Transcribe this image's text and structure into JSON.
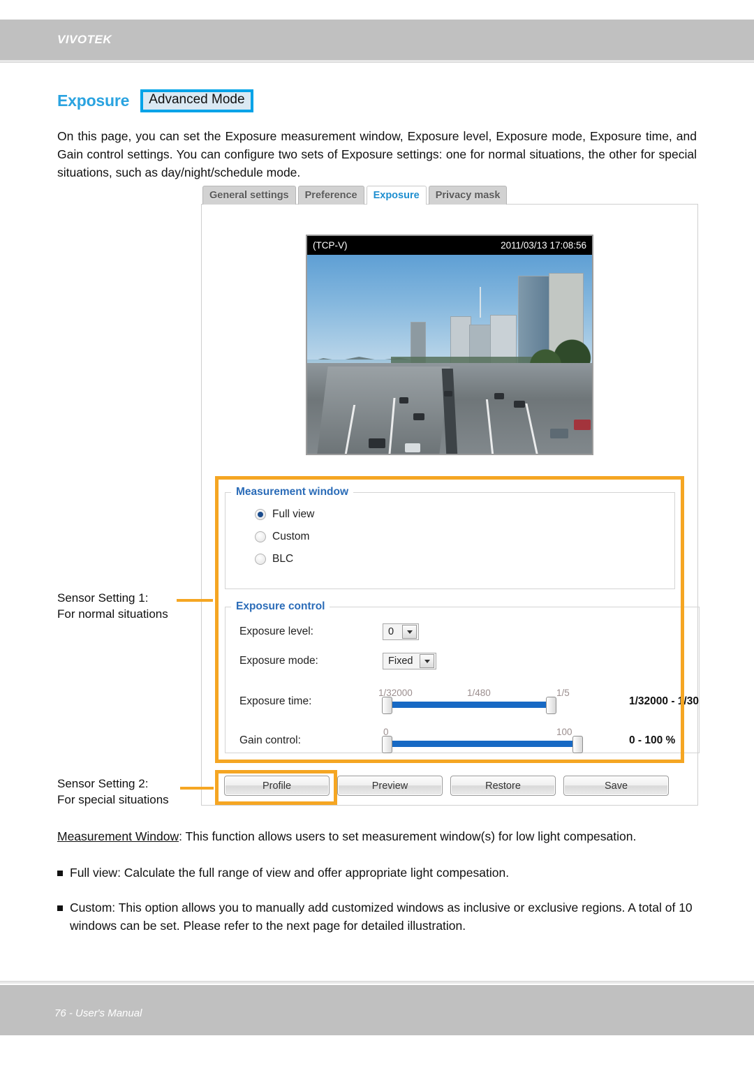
{
  "header": {
    "brand": "VIVOTEK"
  },
  "page": {
    "title": "Exposure",
    "mode_badge": "Advanced Mode",
    "intro": "On this page, you can set the Exposure measurement window, Exposure level, Exposure mode, Exposure time, and Gain control settings. You can configure two sets of Exposure settings: one for normal situations, the other for special situations, such as day/night/schedule mode."
  },
  "screenshot": {
    "tabs": [
      {
        "label": "General settings",
        "active": false
      },
      {
        "label": "Preference",
        "active": false
      },
      {
        "label": "Exposure",
        "active": true
      },
      {
        "label": "Privacy mask",
        "active": false
      }
    ],
    "video": {
      "stream_label": "(TCP-V)",
      "timestamp": "2011/03/13  17:08:56"
    },
    "measurement_window": {
      "legend": "Measurement window",
      "options": [
        {
          "label": "Full view",
          "selected": true
        },
        {
          "label": "Custom",
          "selected": false
        },
        {
          "label": "BLC",
          "selected": false
        }
      ]
    },
    "exposure_control": {
      "legend": "Exposure control",
      "exposure_level": {
        "label": "Exposure level:",
        "value": "0"
      },
      "exposure_mode": {
        "label": "Exposure mode:",
        "value": "Fixed"
      },
      "exposure_time": {
        "label": "Exposure time:",
        "ticks": [
          "1/32000",
          "1/480",
          "1/5"
        ],
        "value": "1/32000 - 1/30"
      },
      "gain_control": {
        "label": "Gain control:",
        "ticks": [
          "0",
          "100"
        ],
        "value": "0 - 100 %"
      }
    },
    "buttons": [
      {
        "label": "Profile",
        "highlighted": true
      },
      {
        "label": "Preview",
        "highlighted": false
      },
      {
        "label": "Restore",
        "highlighted": false
      },
      {
        "label": "Save",
        "highlighted": false
      }
    ]
  },
  "annotations": {
    "sensor1_line1": "Sensor Setting 1:",
    "sensor1_line2": "For normal situations",
    "sensor2_line1": "Sensor Setting 2:",
    "sensor2_line2": "For special situations"
  },
  "body": {
    "measurement_window_term": "Measurement Window",
    "measurement_window_desc": ": This function allows users to set measurement window(s) for low light compesation.",
    "bullets": [
      "Full view: Calculate the full range of view and offer appropriate light compesation.",
      "Custom: This option allows you to manually add customized windows as inclusive or exclusive regions. A total of 10 windows can be set. Please refer to the next page for detailed illustration."
    ]
  },
  "footer": {
    "text": "76 - User's Manual"
  },
  "colors": {
    "brand_gray": "#c0c0c0",
    "title_blue": "#2aa3e0",
    "badge_border": "#00a3e8",
    "legend_blue": "#2b6cb8",
    "highlight_orange": "#f5a623",
    "slider_blue": "#1769c4"
  }
}
